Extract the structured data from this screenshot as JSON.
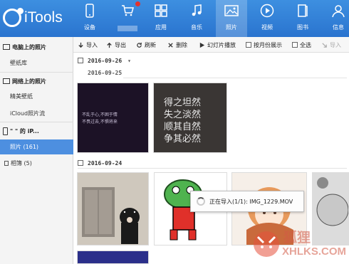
{
  "app": {
    "name": "iTools"
  },
  "nav": [
    {
      "id": "device",
      "label": "设备",
      "icon": "phone-icon"
    },
    {
      "id": "store",
      "label": "",
      "icon": "cart-icon"
    },
    {
      "id": "apps",
      "label": "应用",
      "icon": "apps-grid-icon"
    },
    {
      "id": "music",
      "label": "音乐",
      "icon": "music-note-icon"
    },
    {
      "id": "photos",
      "label": "照片",
      "icon": "photo-icon",
      "active": true
    },
    {
      "id": "video",
      "label": "视频",
      "icon": "play-icon"
    },
    {
      "id": "books",
      "label": "图书",
      "icon": "book-icon"
    },
    {
      "id": "info",
      "label": "信息",
      "icon": "user-icon"
    }
  ],
  "sidebar": {
    "sections": [
      {
        "title": "电脑上的照片",
        "items": [
          "壁纸库"
        ]
      },
      {
        "title": "网络上的照片",
        "items": [
          "精美壁纸",
          "iCloud照片流"
        ]
      },
      {
        "title": "\"   \" 的 iP...",
        "items": [
          "照片 (161)",
          "相簿 (5)"
        ]
      }
    ],
    "selected_item": "照片 (161)"
  },
  "toolbar": {
    "import": "导入",
    "export": "导出",
    "refresh": "刷新",
    "delete": "删除",
    "slideshow": "幻灯片播放",
    "by_month": "按月份展示",
    "select_all": "全选",
    "import_to": "导入"
  },
  "groups": [
    {
      "date_selector": "2016-09-26",
      "date": "2016-09-25"
    },
    {
      "date": "2016-09-24"
    }
  ],
  "thumbs": {
    "t1_text_line1": "不乱于心,不困于情",
    "t1_text_line2": "不畏过去,不惧将来",
    "t2_text": [
      "得之坦然",
      "失之淡然",
      "顺其自然",
      "争其必然"
    ]
  },
  "progress": {
    "text": "正在导入(1/1): IMG_1229.MOV"
  },
  "watermark": {
    "brand": "狐狸",
    "url": "XHLKS.COM"
  },
  "colors": {
    "accent": "#2a74cf",
    "sidebar_selected": "#4d8fe0",
    "badge": "#e2322d"
  }
}
